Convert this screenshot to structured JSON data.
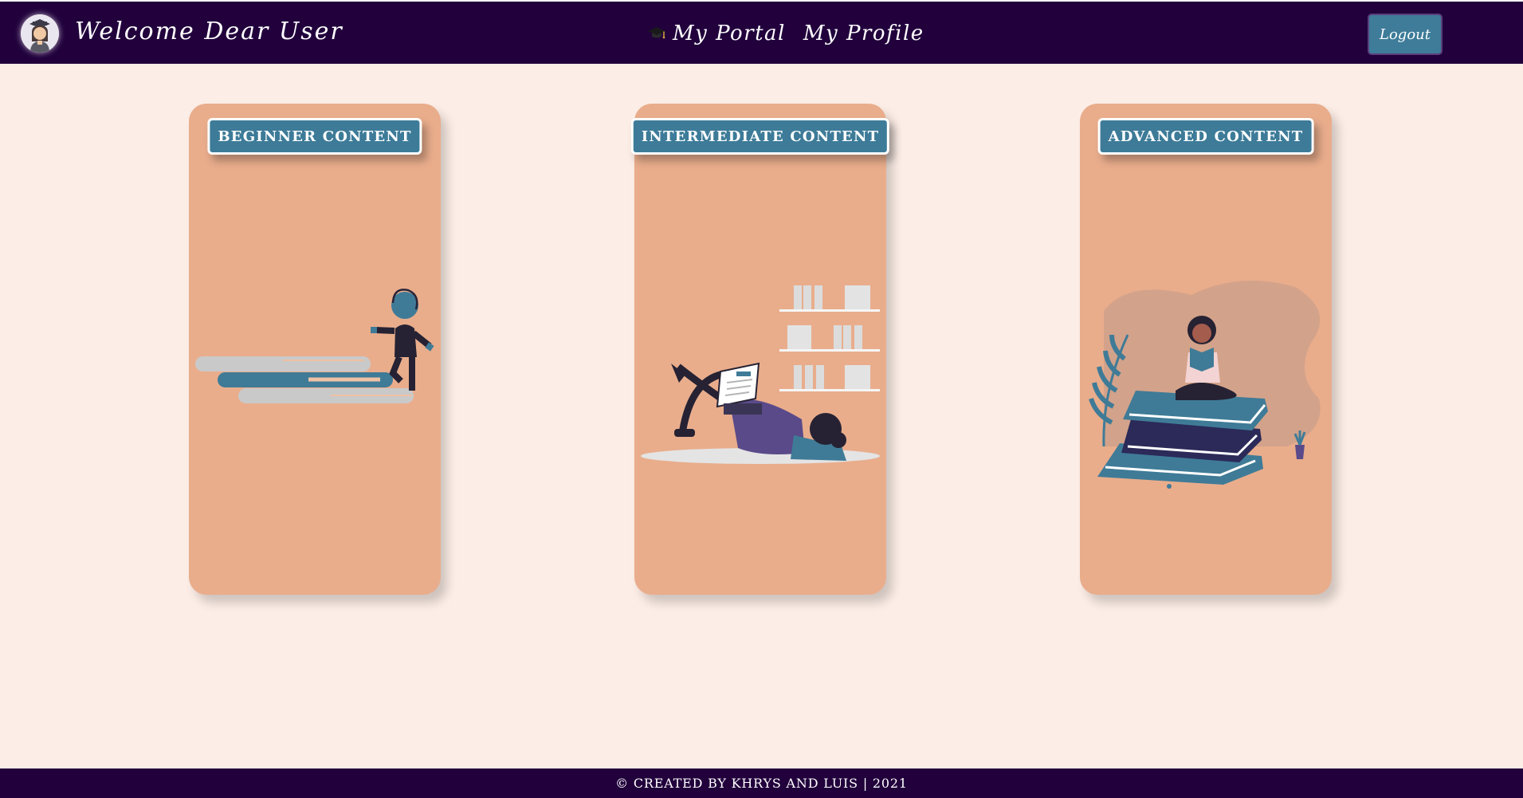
{
  "header": {
    "welcome_text": "Welcome Dear User",
    "nav": [
      {
        "label": "My Portal",
        "icon": "graduation-cap-icon"
      },
      {
        "label": "My Profile"
      }
    ],
    "logout_label": "Logout"
  },
  "cards": [
    {
      "button_label": "BEGINNER CONTENT",
      "illustration": "stairs-climber-illustration"
    },
    {
      "button_label": "INTERMEDIATE CONTENT",
      "illustration": "laptop-reader-illustration"
    },
    {
      "button_label": "ADVANCED CONTENT",
      "illustration": "books-reader-illustration"
    }
  ],
  "footer": {
    "text": "© CREATED BY KHRYS AND LUIS | 2021"
  },
  "colors": {
    "navbar": "#21003c",
    "page_bg": "#fcede6",
    "card_bg": "#e9ad8c",
    "accent": "#3d7b98"
  }
}
